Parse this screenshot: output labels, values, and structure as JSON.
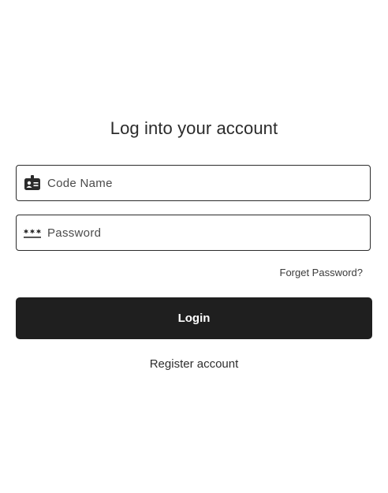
{
  "form": {
    "title": "Log into your account",
    "code_name": {
      "placeholder": "Code Name",
      "value": "",
      "icon": "id-badge-icon"
    },
    "password": {
      "placeholder": "Password",
      "value": "",
      "icon": "password-dots-icon"
    },
    "forgot_label": "Forget Password?",
    "login_label": "Login",
    "register_label": "Register account"
  },
  "colors": {
    "button_bg": "#1f1f1f",
    "button_text": "#ffffff",
    "border": "#2b2b2b",
    "text": "#222222"
  }
}
